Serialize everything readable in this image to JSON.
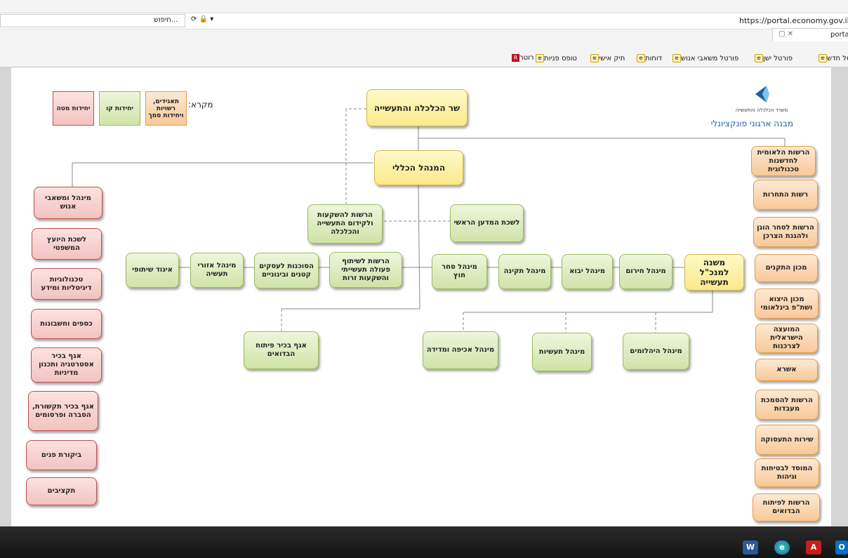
{
  "browser": {
    "url": "https://portal.economy.gov.il/u",
    "search_placeholder": "חיפוש...",
    "tab_label": "porta",
    "favorites": [
      "פורטל חדש",
      "פורטל ישן",
      "פורטל משאבי אנוש",
      "דוחות",
      "תיק אישי",
      "טופס פניות",
      "רוטר"
    ]
  },
  "header": {
    "logo_caption": "משרד הכלכלה והתעשייה",
    "title": "מבנה ארגוני פונקציונלי",
    "legend_label": "מקרא:",
    "legend": [
      "תאגידים, רשויות ויחידות סמך",
      "יחידות קו",
      "יחידות מטה"
    ]
  },
  "chart_data": {
    "type": "org-chart",
    "top": [
      "שר הכלכלה והתעשייה",
      "המנהל הכללי",
      "משנה למנכ\"ל תעשייה"
    ],
    "center": [
      "הרשות להשקעות ולקידום התעשייה והכלכלה",
      "לשכת המדען הראשי"
    ],
    "line_units": [
      "מינהל חירום",
      "מינהל יבוא",
      "מינהל תקינה",
      "מינהל סחר חוץ",
      "הרשות לשיתוף פעולה תעשייתי והשקעות זרות",
      "הסוכנות לעסקים קטנים ובינוניים",
      "מינהל אזורי תעשיה",
      "איגוד שיתופי"
    ],
    "lower_units": [
      "מינהל היהלומים",
      "מינהל תעשיות",
      "מינהל אכיפה ומדידה",
      "אגף בכיר פיתוח הבדואים"
    ],
    "staff_units": [
      "מינהל ומשאבי אנוש",
      "לשכת היועץ המשפטי",
      "טכנולוגיות דיגיטליות ומידע",
      "כספים וחשבונות",
      "אגף בכיר אסטרטגיה ותכנון מדיניות",
      "אגף בכיר תקשורת, הסברה ופרסומים",
      "ביקורת פנים",
      "תקציבים"
    ],
    "corporations": [
      "הרשות הלאומית לחדשנות טכנולוגית",
      "רשות התחרות",
      "הרשות לסחר הוגן ולהגנת הצרכן",
      "מכון התקנים",
      "מכון היצוא ושת\"פ בינלאומי",
      "המועצה הישראלית לצרכנות",
      "אשרא",
      "הרשות להסמכת מעבדות",
      "שירות התעסוקה",
      "המוסד לבטיחות וגיהות",
      "הרשות לפיתוח הבדואים"
    ]
  },
  "colors": {
    "line": "#a0c860",
    "staff": "#f2c3c1",
    "corp": "#f8c998",
    "top": "#fbe98a"
  }
}
